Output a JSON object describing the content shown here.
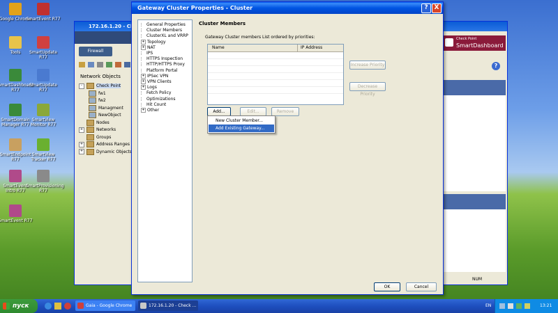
{
  "desktop": {
    "icons": [
      {
        "label": "Google Chrome",
        "color": "#e3a21a"
      },
      {
        "label": "SmartEvent R77",
        "color": "#c03030"
      },
      {
        "label": "Tools",
        "color": "#e8c34a"
      },
      {
        "label": "SmartUpdate R77",
        "color": "#d04040"
      },
      {
        "label": "SmartDashboard R77",
        "color": "#3a8a3a"
      },
      {
        "label": "SmartUpdate R77",
        "color": "#4a7ad0"
      },
      {
        "label": "SmartDomain Manager R77",
        "color": "#3a8a3a"
      },
      {
        "label": "SmartView Monitor R77",
        "color": "#8aa83a"
      },
      {
        "label": "SmartEndpoint R77",
        "color": "#c8a060"
      },
      {
        "label": "SmartView Tracker R77",
        "color": "#6ab030"
      },
      {
        "label": "SmartEvent Intro R77",
        "color": "#b04a8a"
      },
      {
        "label": "SmartProvisioning R77",
        "color": "#8a8a8a"
      },
      {
        "label": "SmartEvent R77",
        "color": "#b04a8a"
      }
    ]
  },
  "bg_window": {
    "title": "172.16.1.20 - Ch",
    "object_tabs": [
      "Firewall"
    ],
    "network_objects_title": "Network Objects",
    "tree": [
      {
        "label": "Check Point",
        "level": 0,
        "expander": "-"
      },
      {
        "label": "fw1",
        "level": 1,
        "expander": ""
      },
      {
        "label": "fw2",
        "level": 1,
        "expander": ""
      },
      {
        "label": "Managment",
        "level": 1,
        "expander": ""
      },
      {
        "label": "NewObject",
        "level": 1,
        "expander": ""
      },
      {
        "label": "Nodes",
        "level": 0,
        "expander": ""
      },
      {
        "label": "Networks",
        "level": 0,
        "expander": "+"
      },
      {
        "label": "Groups",
        "level": 0,
        "expander": ""
      },
      {
        "label": "Address Ranges",
        "level": 0,
        "expander": "+"
      },
      {
        "label": "Dynamic Objects",
        "level": 0,
        "expander": "+"
      }
    ],
    "brand_line1": "Check Point",
    "brand_line2": "SmartDashboard",
    "help_icon": "?",
    "status_num": "NUM"
  },
  "dialog": {
    "title": "Gateway Cluster Properties - Cluster",
    "help_button": "?",
    "close_button": "X",
    "nav_items": [
      {
        "label": "General Properties",
        "sub": false,
        "expander": ""
      },
      {
        "label": "Cluster Members",
        "sub": false,
        "expander": ""
      },
      {
        "label": "ClusterXL and VRRP",
        "sub": false,
        "expander": ""
      },
      {
        "label": "Topology",
        "sub": false,
        "expander": "+"
      },
      {
        "label": "NAT",
        "sub": false,
        "expander": "+"
      },
      {
        "label": "IPS",
        "sub": false,
        "expander": ""
      },
      {
        "label": "HTTPS Inspection",
        "sub": false,
        "expander": ""
      },
      {
        "label": "HTTP/HTTPS Proxy",
        "sub": false,
        "expander": ""
      },
      {
        "label": "Platform Portal",
        "sub": false,
        "expander": ""
      },
      {
        "label": "IPSec VPN",
        "sub": false,
        "expander": "+"
      },
      {
        "label": "VPN Clients",
        "sub": false,
        "expander": "+"
      },
      {
        "label": "Logs",
        "sub": false,
        "expander": "+"
      },
      {
        "label": "Fetch Policy",
        "sub": false,
        "expander": ""
      },
      {
        "label": "Optimizations",
        "sub": false,
        "expander": ""
      },
      {
        "label": "Hit Count",
        "sub": false,
        "expander": ""
      },
      {
        "label": "Other",
        "sub": false,
        "expander": "+"
      }
    ],
    "section_title": "Cluster Members",
    "members_caption": "Gateway Cluster members List ordered by priorities:",
    "table_headers": [
      "Name",
      "IP Address"
    ],
    "buttons": {
      "increase": "Increase Priority",
      "decrease": "Decrease Priority",
      "add": "Add...",
      "edit": "Edit...",
      "remove": "Remove",
      "ok": "OK",
      "cancel": "Cancel"
    },
    "add_menu": [
      {
        "label": "New Cluster Member...",
        "selected": false
      },
      {
        "label": "Add Existing Gateway...",
        "selected": true
      }
    ]
  },
  "taskbar": {
    "start_label": "пуск",
    "tasks": [
      {
        "label": "Gaia - Google Chrome",
        "active": false
      },
      {
        "label": "172.16.1.20 - Check ...",
        "active": true
      }
    ],
    "lang": "EN",
    "time": "13:21"
  },
  "colors": {
    "xp_blue": "#0054e3",
    "dialog_bg": "#ece9d8",
    "menu_highlight": "#316ac5",
    "taskbar": "#1e4fbf",
    "start_green": "#3c9b3c"
  }
}
